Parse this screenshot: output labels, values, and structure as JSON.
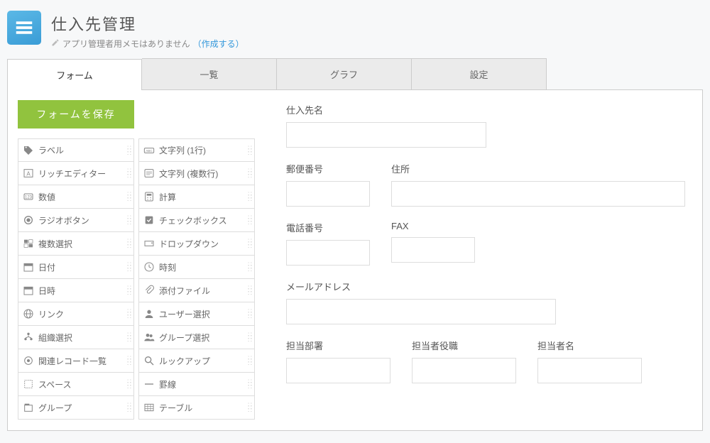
{
  "header": {
    "title": "仕入先管理",
    "memo_prefix": "アプリ管理者用メモはありません",
    "memo_link": "（作成する）"
  },
  "tabs": [
    "フォーム",
    "一覧",
    "グラフ",
    "設定"
  ],
  "active_tab_index": 0,
  "save_button": "フォームを保存",
  "palette": {
    "col1": [
      {
        "icon": "tag",
        "label": "ラベル"
      },
      {
        "icon": "text-a",
        "label": "リッチエディター"
      },
      {
        "icon": "number",
        "label": "数値"
      },
      {
        "icon": "radio",
        "label": "ラジオボタン"
      },
      {
        "icon": "multiselect",
        "label": "複数選択"
      },
      {
        "icon": "calendar",
        "label": "日付"
      },
      {
        "icon": "calendar",
        "label": "日時"
      },
      {
        "icon": "globe",
        "label": "リンク"
      },
      {
        "icon": "org",
        "label": "組織選択"
      },
      {
        "icon": "record",
        "label": "関連レコード一覧"
      },
      {
        "icon": "space",
        "label": "スペース"
      },
      {
        "icon": "group",
        "label": "グループ"
      }
    ],
    "col2": [
      {
        "icon": "abc",
        "label": "文字列 (1行)"
      },
      {
        "icon": "abc-multi",
        "label": "文字列 (複数行)"
      },
      {
        "icon": "calc",
        "label": "計算"
      },
      {
        "icon": "checkbox",
        "label": "チェックボックス"
      },
      {
        "icon": "dropdown",
        "label": "ドロップダウン"
      },
      {
        "icon": "clock",
        "label": "時刻"
      },
      {
        "icon": "attach",
        "label": "添付ファイル"
      },
      {
        "icon": "user",
        "label": "ユーザー選択"
      },
      {
        "icon": "users",
        "label": "グループ選択"
      },
      {
        "icon": "lookup",
        "label": "ルックアップ"
      },
      {
        "icon": "hr",
        "label": "罫線"
      },
      {
        "icon": "table",
        "label": "テーブル"
      }
    ]
  },
  "form_fields": {
    "supplier_name": "仕入先名",
    "postal": "郵便番号",
    "address": "住所",
    "phone": "電話番号",
    "fax": "FAX",
    "email": "メールアドレス",
    "dept": "担当部署",
    "title_role": "担当者役職",
    "contact_name": "担当者名"
  }
}
